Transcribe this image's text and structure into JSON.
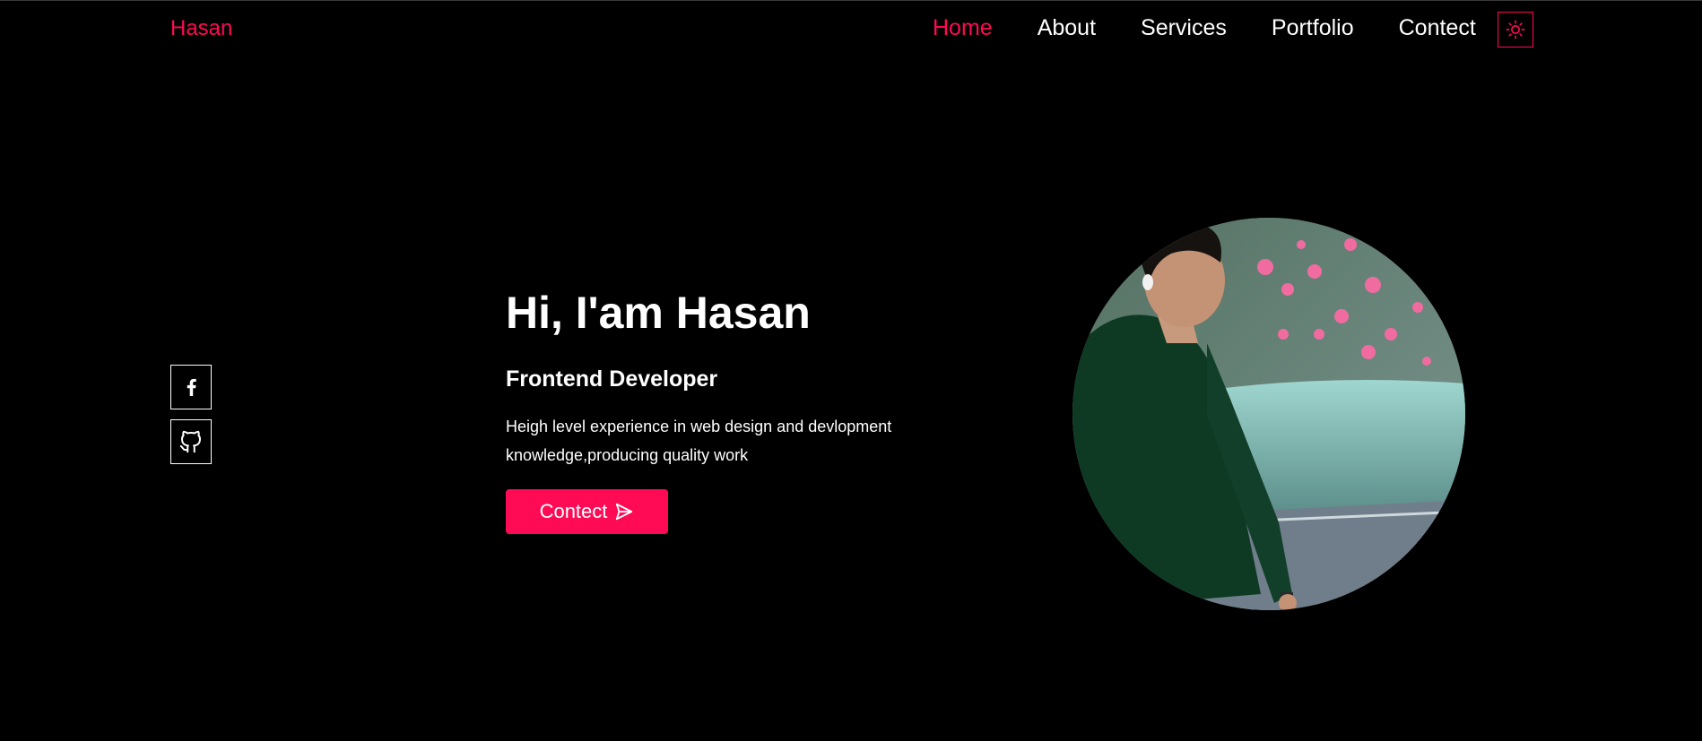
{
  "header": {
    "logo": "Hasan",
    "nav": [
      {
        "label": "Home",
        "active": true
      },
      {
        "label": "About",
        "active": false
      },
      {
        "label": "Services",
        "active": false
      },
      {
        "label": "Portfolio",
        "active": false
      },
      {
        "label": "Contect",
        "active": false
      }
    ],
    "theme_toggle_icon": "sun-icon"
  },
  "social": [
    {
      "icon": "facebook-icon"
    },
    {
      "icon": "github-icon"
    }
  ],
  "hero": {
    "title": "Hi, I'am Hasan",
    "subtitle": "Frontend Developer",
    "description": "Heigh level experience in web design and devlopment knowledge,producing quality work",
    "cta_label": "Contect",
    "cta_icon": "send-icon"
  },
  "portrait": {
    "icon": "profile-photo"
  },
  "colors": {
    "accent": "#ff0a54",
    "background": "#000000",
    "text": "#ffffff"
  }
}
